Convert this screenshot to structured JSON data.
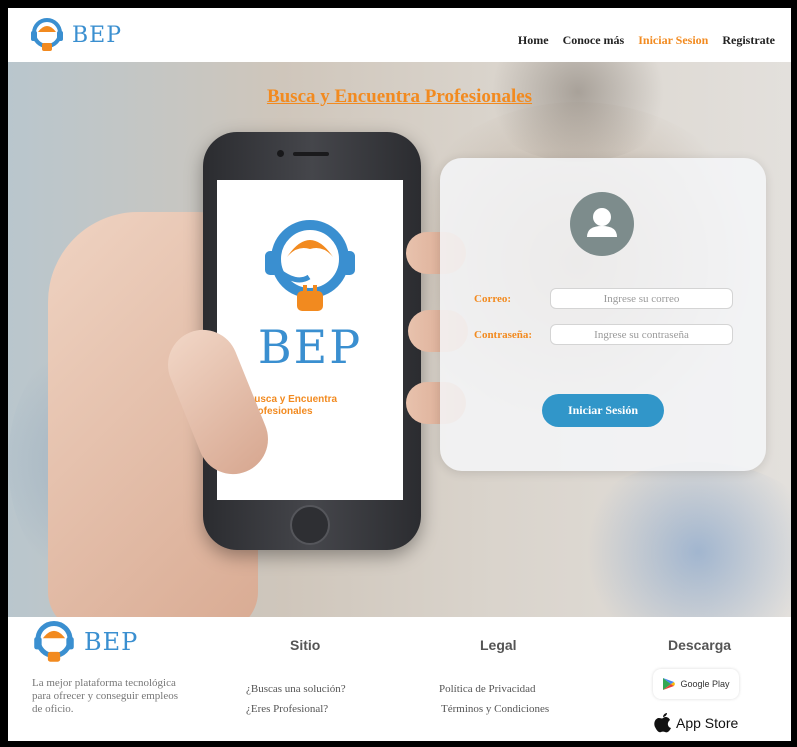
{
  "brand": {
    "name": "BEP",
    "color": "#3a8fd0",
    "accent": "#f28a1f"
  },
  "nav": {
    "items": [
      {
        "label": "Home",
        "active": false
      },
      {
        "label": "Conoce más",
        "active": false
      },
      {
        "label": "Iniciar Sesion",
        "active": true
      },
      {
        "label": "Registrate",
        "active": false
      }
    ]
  },
  "hero": {
    "title": "Busca y Encuentra Profesionales"
  },
  "phone_app": {
    "name": "BEP",
    "tagline": "Busca y Encuentra Profesionales"
  },
  "login": {
    "avatar_icon": "user-icon",
    "email_label": "Correo:",
    "email_placeholder": "Ingrese su correo",
    "password_label": "Contraseña:",
    "password_placeholder": "Ingrese su contraseña",
    "submit_label": "Iniciar Sesión"
  },
  "footer": {
    "logo": "BEP",
    "description": "La mejor plataforma tecnológica para ofrecer y conseguir empleos de oficio.",
    "sitio": {
      "heading": "Sitio",
      "links": [
        "¿Buscas una solución?",
        "¿Eres Profesional?"
      ]
    },
    "legal": {
      "heading": "Legal",
      "links": [
        "Política de Privacidad",
        "Términos y Condiciones"
      ]
    },
    "descarga": {
      "heading": "Descarga",
      "google_play": "Google Play",
      "app_store": "App Store"
    }
  }
}
